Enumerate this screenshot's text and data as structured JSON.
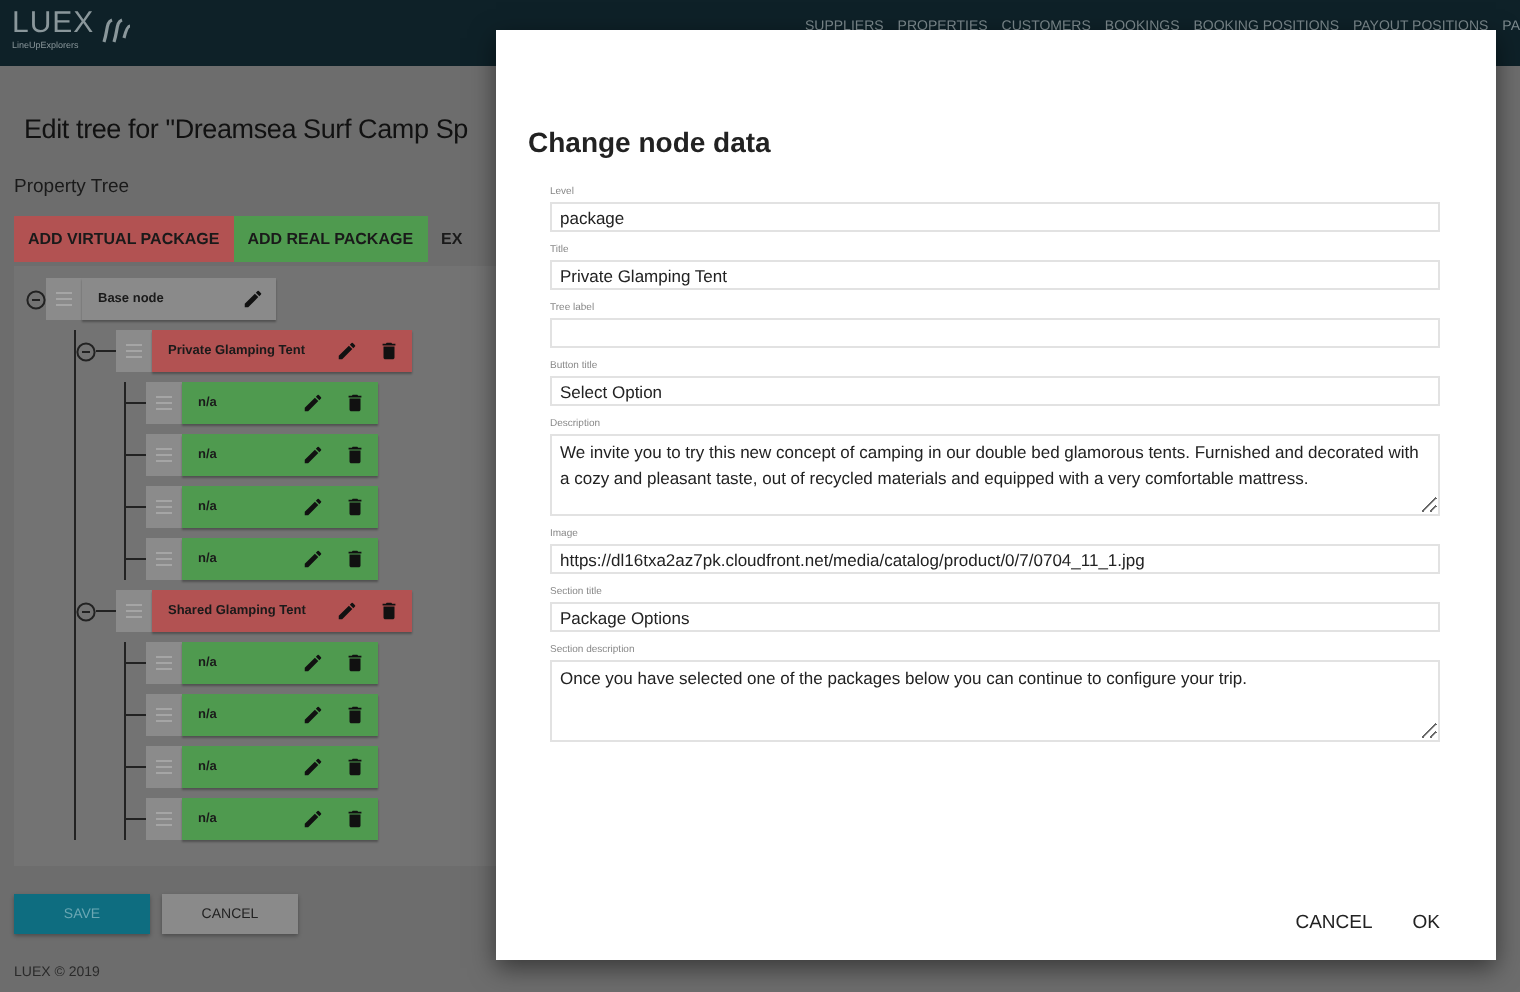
{
  "header": {
    "logo": "LUEX",
    "tagline": "LineUpExplorers",
    "nav": [
      "SUPPLIERS",
      "PROPERTIES",
      "CUSTOMERS",
      "BOOKINGS",
      "BOOKING POSITIONS",
      "PAYOUT POSITIONS",
      "PA"
    ]
  },
  "page_title": "Edit tree for \"Dreamsea Surf Camp Sp",
  "section_label": "Property Tree",
  "toolbar": [
    {
      "label": "ADD VIRTUAL PACKAGE",
      "kind": "virtual"
    },
    {
      "label": "ADD REAL PACKAGE",
      "kind": "real"
    },
    {
      "label": "EX",
      "kind": "plain"
    }
  ],
  "tree": {
    "label": "Base node",
    "kind": "base",
    "expanded": true,
    "children": [
      {
        "label": "Private Glamping Tent",
        "kind": "virtual",
        "expanded": true,
        "children": [
          {
            "label": "n/a",
            "kind": "real"
          },
          {
            "label": "n/a",
            "kind": "real"
          },
          {
            "label": "n/a",
            "kind": "real"
          },
          {
            "label": "n/a",
            "kind": "real"
          }
        ]
      },
      {
        "label": "Shared Glamping Tent",
        "kind": "virtual",
        "expanded": true,
        "children": [
          {
            "label": "n/a",
            "kind": "real"
          },
          {
            "label": "n/a",
            "kind": "real"
          },
          {
            "label": "n/a",
            "kind": "real"
          },
          {
            "label": "n/a",
            "kind": "real"
          }
        ]
      }
    ]
  },
  "actions": [
    {
      "label": "SAVE",
      "kind": "primary"
    },
    {
      "label": "CANCEL",
      "kind": "secondary"
    }
  ],
  "footer": "LUEX © 2019",
  "dialog": {
    "title": "Change node data",
    "fields": [
      {
        "label": "Level",
        "value": "package",
        "kind": "input"
      },
      {
        "label": "Title",
        "value": "Private Glamping Tent",
        "kind": "input"
      },
      {
        "label": "Tree label",
        "kind": "input"
      },
      {
        "label": "Button title",
        "value": "Select Option",
        "kind": "input"
      },
      {
        "label": "Description",
        "value": "We invite you to try this new concept of camping in our double bed glamorous tents. Furnished and decorated with a cozy and pleasant taste, out of recycled materials and equipped with a very comfortable mattress.",
        "kind": "textarea"
      },
      {
        "label": "Image",
        "value": "https://dl16txa2az7pk.cloudfront.net/media/catalog/product/0/7/0704_11_1.jpg",
        "kind": "input"
      },
      {
        "label": "Section title",
        "value": "Package Options",
        "kind": "input"
      },
      {
        "label": "Section description",
        "value": "Once you have selected one of the packages below you can continue to configure your trip.",
        "kind": "textarea"
      }
    ],
    "buttons": [
      "CANCEL",
      "OK"
    ]
  }
}
